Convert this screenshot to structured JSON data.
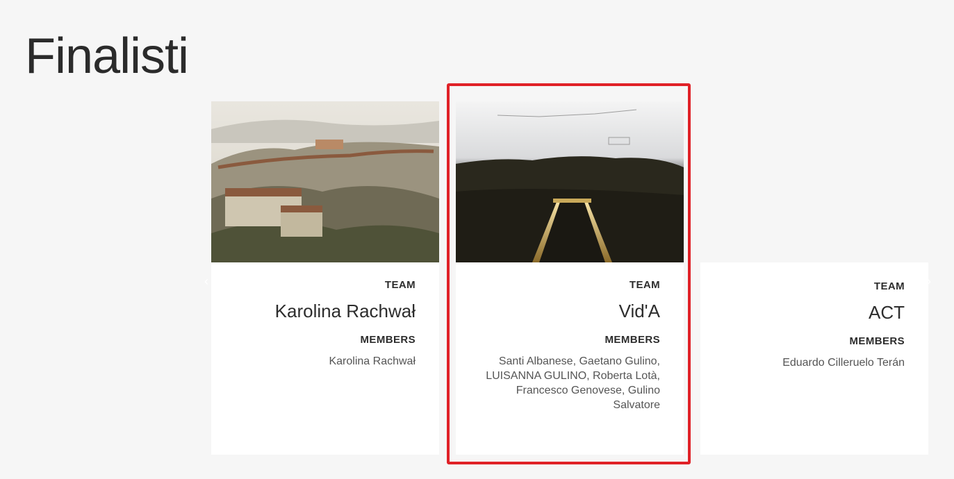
{
  "page": {
    "title": "Finalisti"
  },
  "labels": {
    "team": "TEAM",
    "members": "MEMBERS"
  },
  "cards": [
    {
      "team_name": "Karolina Rachwał",
      "members": "Karolina Rachwał"
    },
    {
      "team_name": "Vid'A",
      "members": "Santi Albanese, Gaetano Gulino, LUISANNA GULINO, Roberta Lotà, Francesco Genovese, Gulino Salvatore"
    },
    {
      "team_name": "ACT",
      "members": "Eduardo Cilleruelo Terán"
    }
  ],
  "colors": {
    "background": "#f6f6f6",
    "card": "#ffffff",
    "highlight": "#e02127"
  },
  "icons": {
    "prev": "chevron-left-icon",
    "next": "chevron-right-icon"
  }
}
